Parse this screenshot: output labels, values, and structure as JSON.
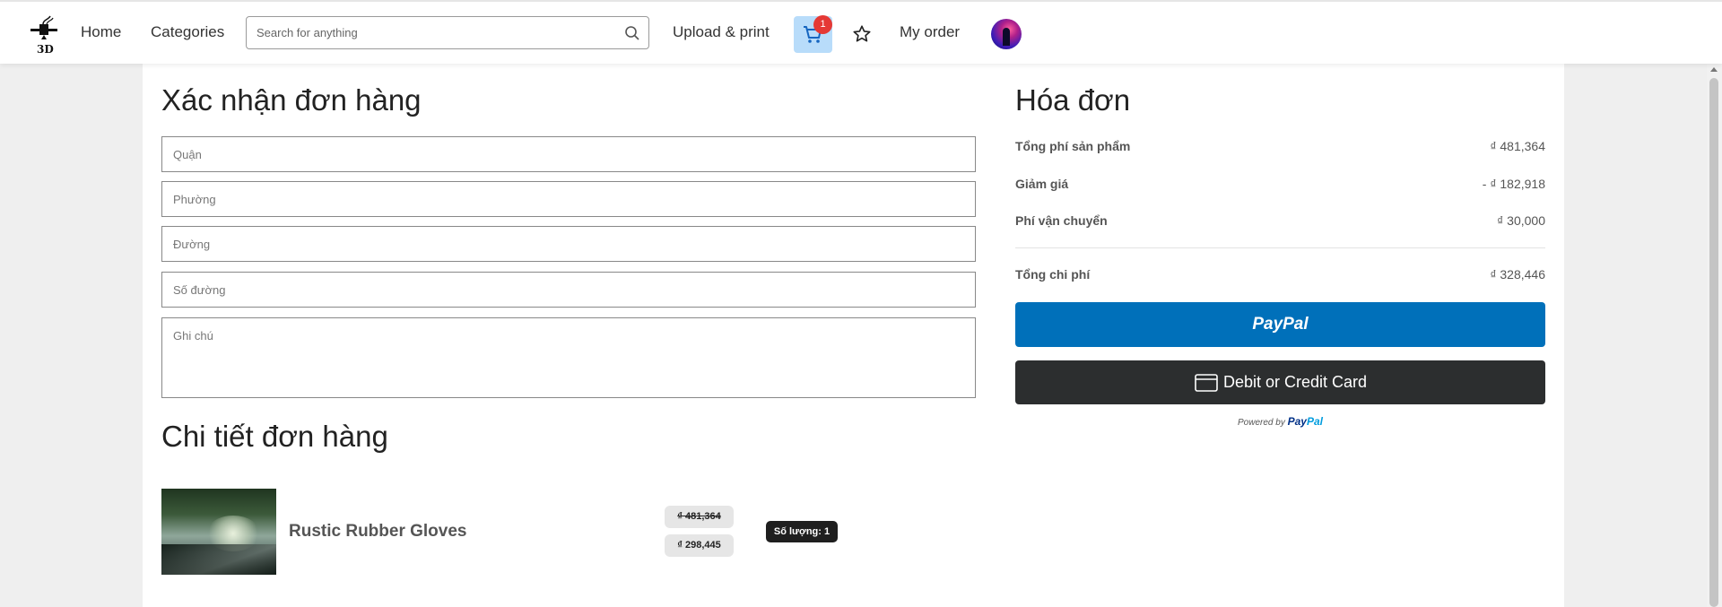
{
  "nav": {
    "logo_text": "3D",
    "home": "Home",
    "categories": "Categories",
    "search_placeholder": "Search for anything",
    "upload_print": "Upload & print",
    "cart_count": "1",
    "my_order": "My order",
    "icons": [
      "printer-logo-icon",
      "search-icon",
      "cart-icon",
      "star-icon",
      "avatar"
    ]
  },
  "order_form": {
    "title": "Xác nhận đơn hàng",
    "district_placeholder": "Quận",
    "ward_placeholder": "Phường",
    "street_placeholder": "Đường",
    "street_number_placeholder": "Số đường",
    "note_placeholder": "Ghi chú"
  },
  "invoice": {
    "title": "Hóa đơn",
    "rows": [
      {
        "label": "Tổng phí sản phẩm",
        "value": "₫ 481,364"
      },
      {
        "label": "Giảm giá",
        "value": "- ₫ 182,918"
      },
      {
        "label": "Phí vận chuyển",
        "value": "₫ 30,000"
      }
    ],
    "total": {
      "label": "Tổng chi phí",
      "value": "₫ 328,446"
    },
    "paypal_button": "PayPal",
    "card_button": "Debit or Credit Card",
    "powered_by": "Powered by",
    "powered_brand_a": "Pay",
    "powered_brand_b": "Pal"
  },
  "order_detail": {
    "title": "Chi tiết đơn hàng",
    "items": [
      {
        "name": "Rustic Rubber Gloves",
        "old_price": "₫ 481,364",
        "new_price": "₫ 298,445",
        "quantity": "Số lượng: 1"
      }
    ]
  },
  "colors": {
    "paypal_blue": "#0070ba",
    "card_dark": "#2c2e2f",
    "cart_highlight": "#b8dcfa",
    "badge_red": "#e53935"
  }
}
